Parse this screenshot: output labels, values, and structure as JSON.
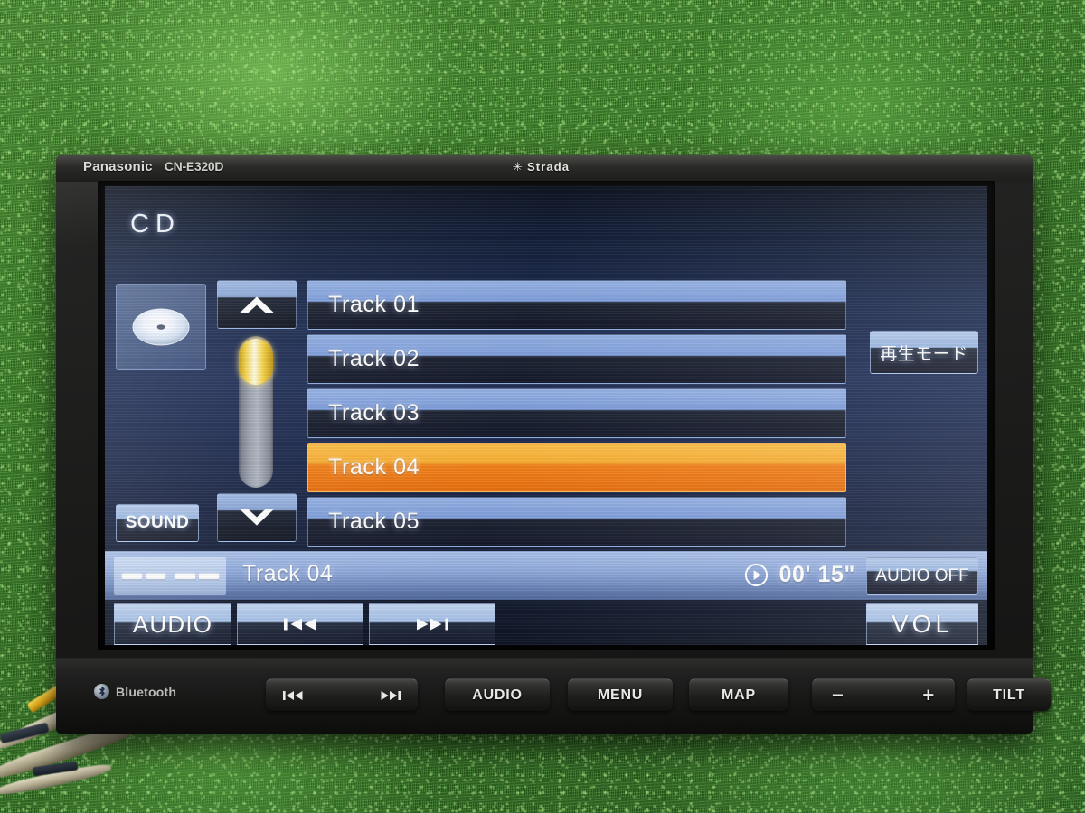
{
  "device": {
    "brand": "Panasonic",
    "model": "CN-E320D",
    "series": "Strada",
    "series_mark": "✳"
  },
  "screen": {
    "source_label": "CD",
    "disc_tile_icon": "cd-disc-icon",
    "sound_label": "SOUND",
    "playmode_label": "再生モード",
    "scroll": {
      "up_icon": "chevron-up-icon",
      "down_icon": "chevron-down-icon",
      "thumb_position_percent": 2,
      "thumb_size_percent": 30
    },
    "tracks": [
      {
        "label": "Track 01",
        "selected": false
      },
      {
        "label": "Track 02",
        "selected": false
      },
      {
        "label": "Track 03",
        "selected": false
      },
      {
        "label": "Track 04",
        "selected": true
      },
      {
        "label": "Track 05",
        "selected": false
      }
    ],
    "status": {
      "disc_indicator": "–– ––",
      "now_playing": "Track 04",
      "play_icon": "play-circle-icon",
      "elapsed_time": "00' 15\"",
      "audio_off_label": "AUDIO OFF"
    },
    "controls": {
      "audio_label": "AUDIO",
      "prev_icon": "skip-previous-icon",
      "next_icon": "skip-next-icon",
      "vol_label": "VOL"
    }
  },
  "hardware": {
    "bluetooth_label": "Bluetooth",
    "bluetooth_icon": "bluetooth-icon",
    "skip_prev_icon": "skip-previous-icon",
    "skip_next_icon": "skip-next-icon",
    "audio_label": "AUDIO",
    "menu_label": "MENU",
    "map_label": "MAP",
    "vol_down_label": "−",
    "vol_up_label": "+",
    "tilt_label": "TILT"
  },
  "colors": {
    "accent_selected": "#f1801a",
    "accent_scroll_thumb": "#f3cf3e",
    "lcd_blue": "#223159",
    "button_blue": "#9ab6e0",
    "turf_green": "#3f8b28"
  }
}
